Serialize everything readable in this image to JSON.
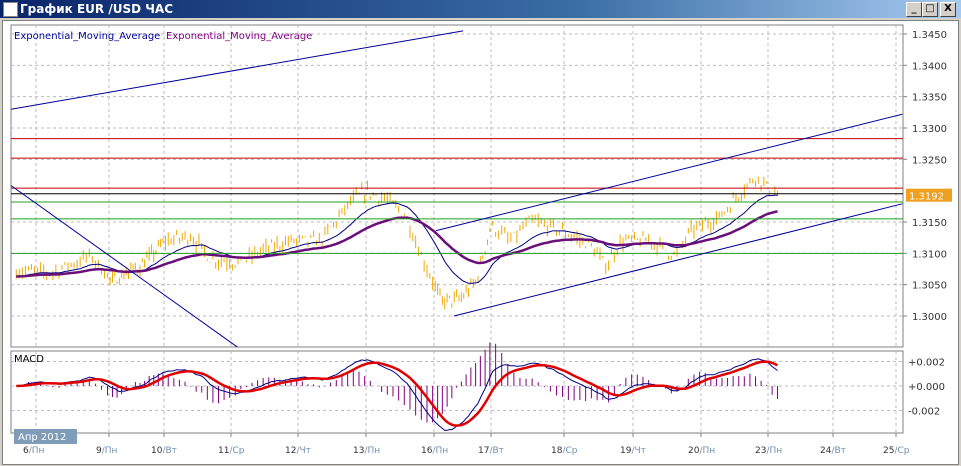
{
  "window": {
    "title": "График EUR /USD  ЧАС",
    "minimize": "_",
    "maximize": "□",
    "close": "X"
  },
  "legend": {
    "ema1": "Exponential_Moving_Average",
    "ema2": "Exponential_Moving_Average"
  },
  "macd_label": "MACD",
  "period_label": "Апр 2012",
  "current_price": "1.3192",
  "colors": {
    "candle": "#f0a800",
    "ema_fast": "#000080",
    "ema_slow": "#6a0f7a",
    "macd_line": "#e00000",
    "signal": "#000080",
    "hist": "#800080",
    "resistance": "#c00000",
    "support": "#20a020",
    "trend": "#0000a0",
    "price_tag": "#f0a020"
  },
  "chart_data": {
    "type": "line",
    "title": "EUR/USD H1",
    "x_ticks": [
      {
        "d": "6",
        "w": "Пн"
      },
      {
        "d": "9",
        "w": "Пн"
      },
      {
        "d": "10",
        "w": "Вт"
      },
      {
        "d": "11",
        "w": "Ср"
      },
      {
        "d": "12",
        "w": "Чт"
      },
      {
        "d": "13",
        "w": "Пн"
      },
      {
        "d": "16",
        "w": "Пн"
      },
      {
        "d": "17",
        "w": "Вт"
      },
      {
        "d": "18",
        "w": "Ср"
      },
      {
        "d": "19",
        "w": "Чт"
      },
      {
        "d": "20",
        "w": "Пн"
      },
      {
        "d": "23",
        "w": "Пн"
      },
      {
        "d": "24",
        "w": "Вт"
      },
      {
        "d": "25",
        "w": "Ср"
      }
    ],
    "y_ticks": [
      "1.3450",
      "1.3400",
      "1.3350",
      "1.3300",
      "1.3250",
      "1.3150",
      "1.3100",
      "1.3050",
      "1.3000"
    ],
    "ylim": [
      1.295,
      1.3465
    ],
    "macd_ticks": [
      "+0.002",
      "+0.000",
      "-0.002"
    ],
    "macd_ylim": [
      -0.0035,
      0.0028
    ],
    "price_path": [
      [
        -0.27,
        1.3072
      ],
      [
        0.21,
        1.3069
      ],
      [
        0.75,
        1.3096
      ],
      [
        1.04,
        1.3056
      ],
      [
        1.58,
        1.308
      ],
      [
        2.03,
        1.312
      ],
      [
        2.4,
        1.3128
      ],
      [
        2.7,
        1.3091
      ],
      [
        3.15,
        1.3085
      ],
      [
        3.45,
        1.3104
      ],
      [
        3.9,
        1.312
      ],
      [
        4.34,
        1.312
      ],
      [
        4.78,
        1.3183
      ],
      [
        5.0,
        1.3199
      ],
      [
        5.29,
        1.3187
      ],
      [
        5.59,
        1.316
      ],
      [
        5.81,
        1.3096
      ],
      [
        6.12,
        1.3024
      ],
      [
        6.47,
        1.3027
      ],
      [
        6.74,
        1.3056
      ],
      [
        7.0,
        1.3144
      ],
      [
        7.27,
        1.312
      ],
      [
        7.55,
        1.3152
      ],
      [
        7.96,
        1.3136
      ],
      [
        8.39,
        1.3112
      ],
      [
        8.61,
        1.308
      ],
      [
        8.83,
        1.312
      ],
      [
        9.26,
        1.312
      ],
      [
        9.63,
        1.3096
      ],
      [
        9.85,
        1.3136
      ],
      [
        10.3,
        1.316
      ],
      [
        10.6,
        1.3199
      ],
      [
        10.82,
        1.3223
      ],
      [
        11.05,
        1.3199
      ],
      [
        11.15,
        1.3192
      ]
    ],
    "horizontal_levels": [
      {
        "price": 1.3283,
        "kind": "resistance"
      },
      {
        "price": 1.3252,
        "kind": "resistance"
      },
      {
        "price": 1.3204,
        "kind": "resistance"
      },
      {
        "price": 1.3195,
        "kind": "current"
      },
      {
        "price": 1.3182,
        "kind": "support"
      },
      {
        "price": 1.3155,
        "kind": "support"
      },
      {
        "price": 1.31,
        "kind": "support"
      }
    ],
    "trend_lines": [
      [
        [
          -0.34,
          1.333
        ],
        [
          6.51,
          1.3455
        ]
      ],
      [
        [
          6.03,
          1.3136
        ],
        [
          13.1,
          1.3322
        ]
      ],
      [
        [
          6.35,
          1.3
        ],
        [
          13.1,
          1.3179
        ]
      ],
      [
        [
          -0.34,
          1.3208
        ],
        [
          3.1,
          1.295
        ]
      ]
    ]
  }
}
